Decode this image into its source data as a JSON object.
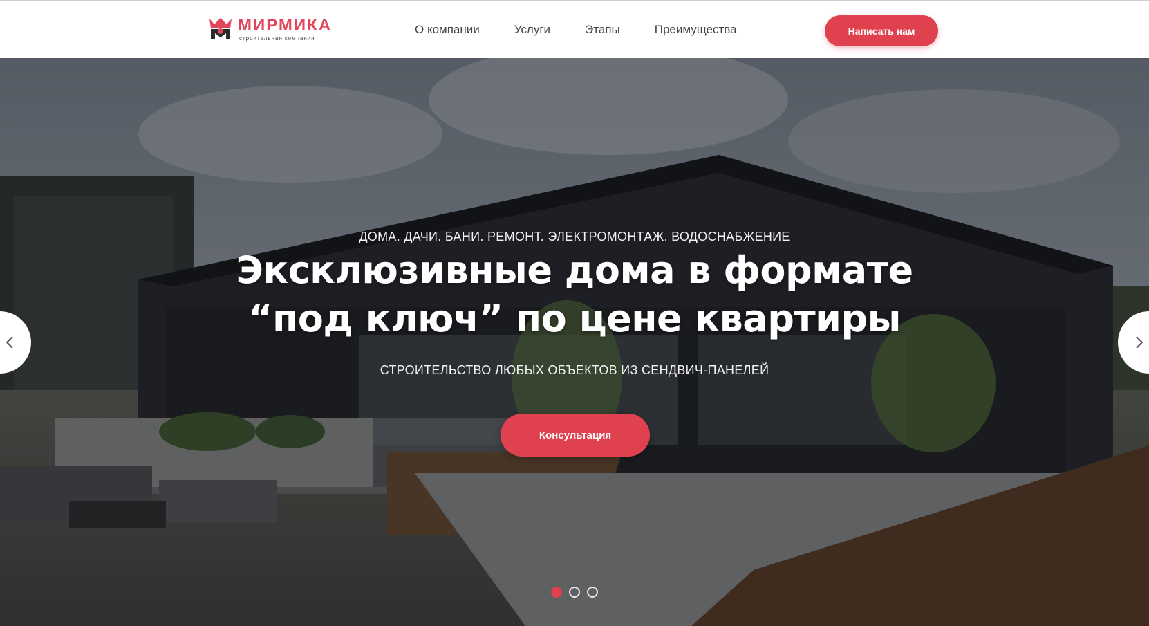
{
  "colors": {
    "accent": "#e0414f",
    "nav_text": "#444444",
    "hero_text": "#ffffff"
  },
  "header": {
    "logo": {
      "name": "МИРМИКА",
      "tagline": "строительная компания",
      "icon": "crown-logo-icon"
    },
    "nav": [
      {
        "label": "О компании"
      },
      {
        "label": "Услуги"
      },
      {
        "label": "Этапы"
      },
      {
        "label": "Преимущества"
      }
    ],
    "cta_label": "Написать нам"
  },
  "hero": {
    "supertitle": "ДОМА. ДАЧИ. БАНИ. РЕМОНТ. ЭЛЕКТРОМОНТАЖ. ВОДОСНАБЖЕНИЕ",
    "title_line1": "Эксклюзивные дома в формате",
    "title_line2": "“под ключ” по цене квартиры",
    "subtitle": "СТРОИТЕЛЬСТВО ЛЮБЫХ ОБЪЕКТОВ ИЗ СЕНДВИЧ-ПАНЕЛЕЙ",
    "cta_label": "Консультация",
    "prev_icon": "chevron-left-icon",
    "next_icon": "chevron-right-icon",
    "slides_total": 3,
    "active_slide": 1
  }
}
